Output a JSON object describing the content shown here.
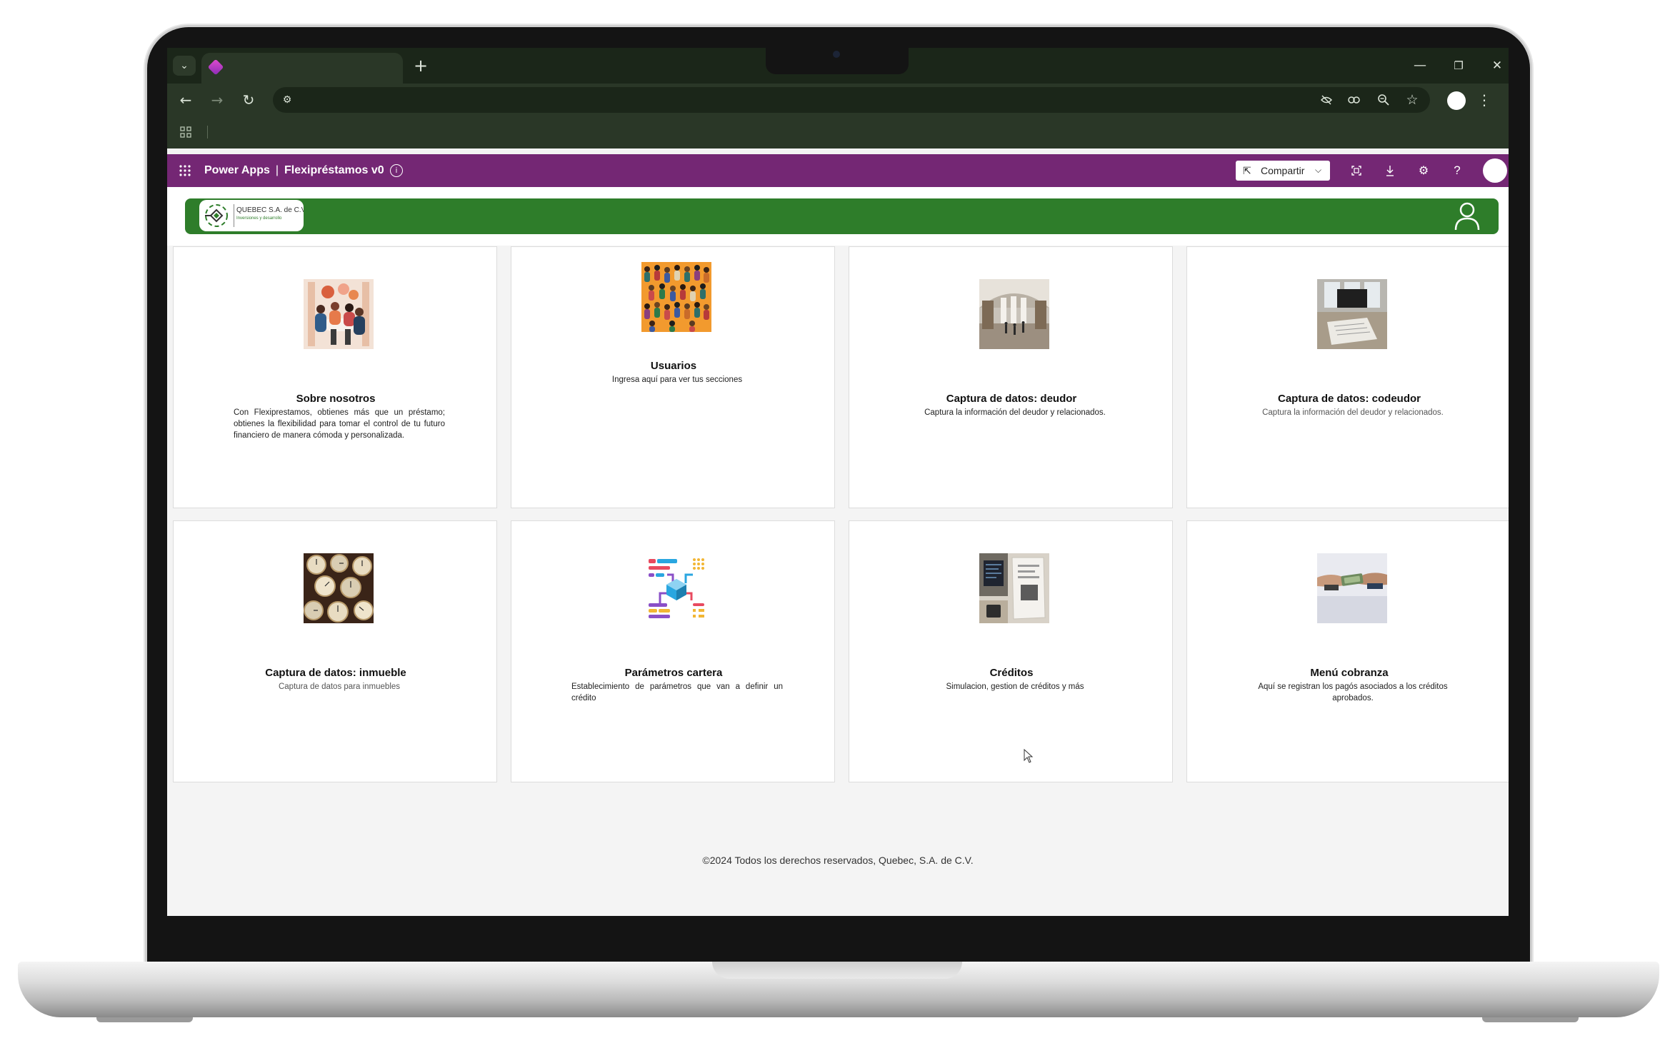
{
  "browser": {
    "new_tab_label": "+",
    "window_controls": {
      "minimize": "—",
      "restore": "❐",
      "close": "✕"
    },
    "nav": {
      "back": "←",
      "forward": "→",
      "reload": "↻"
    },
    "icons": [
      "eye-off-icon",
      "key-icon",
      "zoom-icon",
      "star-icon"
    ]
  },
  "header": {
    "app_name": "Power Apps",
    "separator": "|",
    "app_title": "Flexipréstamos v0",
    "info_glyph": "i",
    "share_label": "Compartir",
    "accent_color": "#742774"
  },
  "banner": {
    "logo_name": "QUEBEC S.A. de C.V.",
    "logo_tagline": "Inversiones y desarrollo",
    "color": "#2e7d2a"
  },
  "cards": [
    {
      "title": "Sobre nosotros",
      "description": "Con Flexiprestamos, obtienes más que un préstamo; obtienes la flexibilidad para tomar el control de tu futuro financiero de manera cómoda y personalizada.",
      "image": "team-meeting-illustration"
    },
    {
      "title": "Usuarios",
      "description": "Ingresa aquí para ver tus secciones",
      "image": "crowd-illustration"
    },
    {
      "title": "Captura de datos: deudor",
      "description": "Captura la información del deudor y relacionados.",
      "image": "office-lobby-photo"
    },
    {
      "title": "Captura de datos: codeudor",
      "description": "Captura la información del deudor y relacionados.",
      "image": "desk-documents-photo"
    },
    {
      "title": "Captura de datos: inmueble",
      "description": "Captura de datos para inmuebles",
      "image": "pocket-watches-photo"
    },
    {
      "title": "Parámetros cartera",
      "description": "Establecimiento de parámetros que van a definir un crédito",
      "image": "parameters-diagram-icon"
    },
    {
      "title": "Créditos",
      "description": "Simulacion, gestion de créditos y más",
      "image": "accounting-photo"
    },
    {
      "title": "Menú cobranza",
      "description": "Aquí se registran los pagós asociados a los créditos aprobados.",
      "image": "money-handshake-photo"
    }
  ],
  "footer": {
    "text": "©2024 Todos los derechos reservados, Quebec, S.A. de C.V."
  }
}
